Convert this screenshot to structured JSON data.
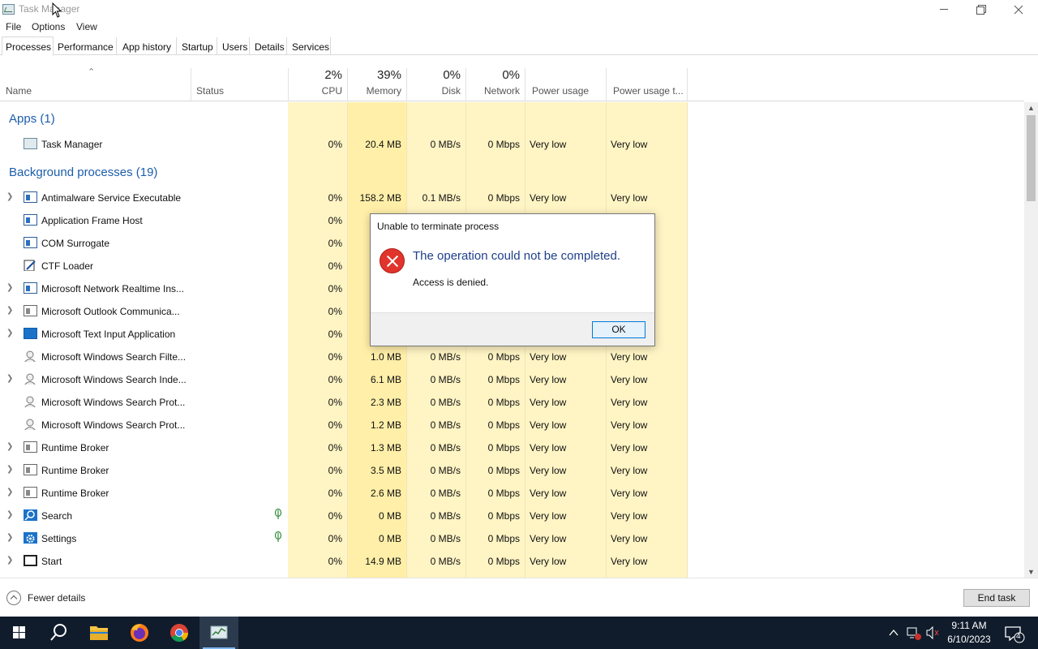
{
  "window": {
    "title": "Task Manager"
  },
  "menu": [
    "File",
    "Options",
    "View"
  ],
  "tabs": [
    "Processes",
    "Performance",
    "App history",
    "Startup",
    "Users",
    "Details",
    "Services"
  ],
  "columns": {
    "name": "Name",
    "status": "Status",
    "cpu": {
      "pct": "2%",
      "label": "CPU"
    },
    "memory": {
      "pct": "39%",
      "label": "Memory"
    },
    "disk": {
      "pct": "0%",
      "label": "Disk"
    },
    "network": {
      "pct": "0%",
      "label": "Network"
    },
    "power": "Power usage",
    "power_trend": "Power usage t..."
  },
  "groups": {
    "apps": "Apps (1)",
    "background": "Background processes (19)"
  },
  "apps": [
    {
      "name": "Task Manager",
      "cpu": "0%",
      "memory": "20.4 MB",
      "disk": "0 MB/s",
      "network": "0 Mbps",
      "power": "Very low",
      "power_trend": "Very low"
    }
  ],
  "processes": [
    {
      "name": "Antimalware Service Executable",
      "cpu": "0%",
      "memory": "158.2 MB",
      "disk": "0.1 MB/s",
      "network": "0 Mbps",
      "power": "Very low",
      "power_trend": "Very low"
    },
    {
      "name": "Application Frame Host",
      "cpu": "0%",
      "memory": "",
      "disk": "",
      "network": "",
      "power": "",
      "power_trend": ""
    },
    {
      "name": "COM Surrogate",
      "cpu": "0%",
      "memory": "",
      "disk": "",
      "network": "",
      "power": "",
      "power_trend": ""
    },
    {
      "name": "CTF Loader",
      "cpu": "0%",
      "memory": "",
      "disk": "",
      "network": "",
      "power": "",
      "power_trend": ""
    },
    {
      "name": "Microsoft Network Realtime Ins...",
      "cpu": "0%",
      "memory": "",
      "disk": "",
      "network": "",
      "power": "",
      "power_trend": ""
    },
    {
      "name": "Microsoft Outlook Communica...",
      "cpu": "0%",
      "memory": "",
      "disk": "",
      "network": "",
      "power": "",
      "power_trend": ""
    },
    {
      "name": "Microsoft Text Input Application",
      "cpu": "0%",
      "memory": "",
      "disk": "",
      "network": "",
      "power": "",
      "power_trend": ""
    },
    {
      "name": "Microsoft Windows Search Filte...",
      "cpu": "0%",
      "memory": "1.0 MB",
      "disk": "0 MB/s",
      "network": "0 Mbps",
      "power": "Very low",
      "power_trend": "Very low"
    },
    {
      "name": "Microsoft Windows Search Inde...",
      "cpu": "0%",
      "memory": "6.1 MB",
      "disk": "0 MB/s",
      "network": "0 Mbps",
      "power": "Very low",
      "power_trend": "Very low"
    },
    {
      "name": "Microsoft Windows Search Prot...",
      "cpu": "0%",
      "memory": "2.3 MB",
      "disk": "0 MB/s",
      "network": "0 Mbps",
      "power": "Very low",
      "power_trend": "Very low"
    },
    {
      "name": "Microsoft Windows Search Prot...",
      "cpu": "0%",
      "memory": "1.2 MB",
      "disk": "0 MB/s",
      "network": "0 Mbps",
      "power": "Very low",
      "power_trend": "Very low"
    },
    {
      "name": "Runtime Broker",
      "cpu": "0%",
      "memory": "1.3 MB",
      "disk": "0 MB/s",
      "network": "0 Mbps",
      "power": "Very low",
      "power_trend": "Very low"
    },
    {
      "name": "Runtime Broker",
      "cpu": "0%",
      "memory": "3.5 MB",
      "disk": "0 MB/s",
      "network": "0 Mbps",
      "power": "Very low",
      "power_trend": "Very low"
    },
    {
      "name": "Runtime Broker",
      "cpu": "0%",
      "memory": "2.6 MB",
      "disk": "0 MB/s",
      "network": "0 Mbps",
      "power": "Very low",
      "power_trend": "Very low"
    },
    {
      "name": "Search",
      "cpu": "0%",
      "memory": "0 MB",
      "disk": "0 MB/s",
      "network": "0 Mbps",
      "power": "Very low",
      "power_trend": "Very low"
    },
    {
      "name": "Settings",
      "cpu": "0%",
      "memory": "0 MB",
      "disk": "0 MB/s",
      "network": "0 Mbps",
      "power": "Very low",
      "power_trend": "Very low"
    },
    {
      "name": "Start",
      "cpu": "0%",
      "memory": "14.9 MB",
      "disk": "0 MB/s",
      "network": "0 Mbps",
      "power": "Very low",
      "power_trend": "Very low"
    }
  ],
  "footer": {
    "fewer_details": "Fewer details",
    "end_task": "End task"
  },
  "dialog": {
    "title": "Unable to terminate process",
    "main_instruction": "The operation could not be completed.",
    "content": "Access is denied.",
    "ok": "OK"
  },
  "taskbar": {
    "time": "9:11 AM",
    "date": "6/10/2023",
    "notification_count": "4"
  }
}
